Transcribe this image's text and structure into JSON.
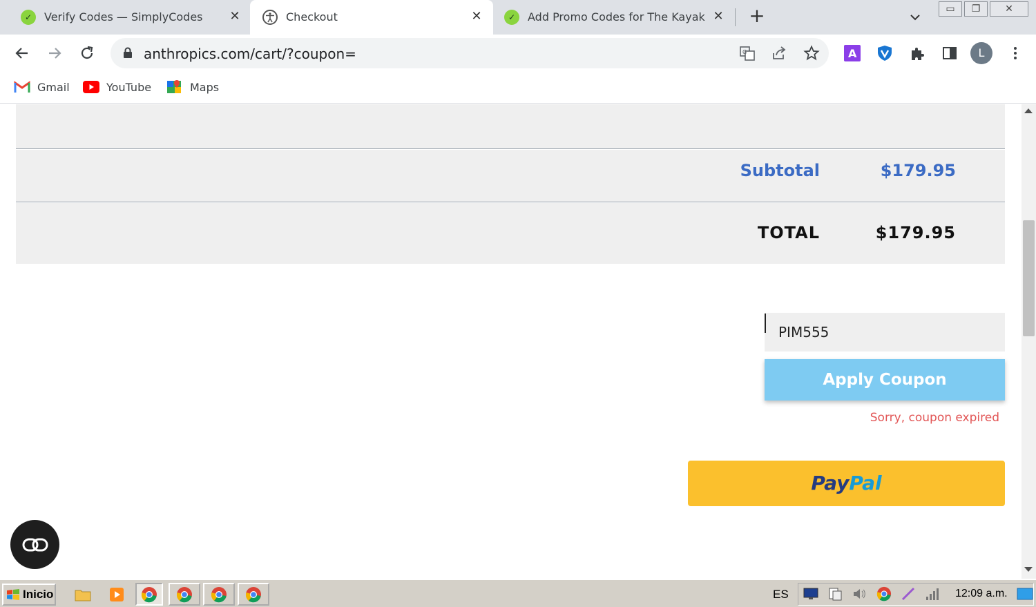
{
  "browser": {
    "tabs": [
      {
        "title": "Verify Codes — SimplyCodes",
        "active": false
      },
      {
        "title": "Checkout",
        "active": true
      },
      {
        "title": "Add Promo Codes for The Kayak Lea",
        "active": false
      }
    ],
    "url": "anthropics.com/cart/?coupon=",
    "profile_initial": "L",
    "bookmarks": [
      "Gmail",
      "YouTube",
      "Maps"
    ]
  },
  "cart": {
    "subtotal_label": "Subtotal",
    "subtotal_value": "$179.95",
    "total_label": "TOTAL",
    "total_value": "$179.95"
  },
  "coupon": {
    "input_value": "PIM555",
    "apply_label": "Apply Coupon",
    "error_message": "Sorry, coupon expired"
  },
  "paypal": {
    "part1": "Pay",
    "part2": "Pal"
  },
  "taskbar": {
    "start_label": "Inicio",
    "language": "ES",
    "clock": "12:09 a.m."
  },
  "colors": {
    "subtotal_text": "#3b6bc4",
    "apply_button": "#7ecbf2",
    "error_text": "#e25555",
    "paypal_button": "#fbc02d"
  }
}
